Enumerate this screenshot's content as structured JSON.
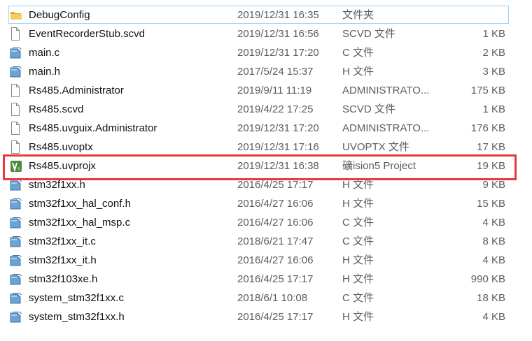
{
  "files": [
    {
      "name": "DebugConfig",
      "date": "2019/12/31 16:35",
      "type": "文件夹",
      "size": "",
      "icon": "folder-icon"
    },
    {
      "name": "EventRecorderStub.scvd",
      "date": "2019/12/31 16:56",
      "type": "SCVD 文件",
      "size": "1 KB",
      "icon": "document-icon"
    },
    {
      "name": "main.c",
      "date": "2019/12/31 17:20",
      "type": "C 文件",
      "size": "2 KB",
      "icon": "source-file-icon"
    },
    {
      "name": "main.h",
      "date": "2017/5/24 15:37",
      "type": "H 文件",
      "size": "3 KB",
      "icon": "source-file-icon"
    },
    {
      "name": "Rs485.Administrator",
      "date": "2019/9/11 11:19",
      "type": "ADMINISTRATO...",
      "size": "175 KB",
      "icon": "document-icon"
    },
    {
      "name": "Rs485.scvd",
      "date": "2019/4/22 17:25",
      "type": "SCVD 文件",
      "size": "1 KB",
      "icon": "document-icon"
    },
    {
      "name": "Rs485.uvguix.Administrator",
      "date": "2019/12/31 17:20",
      "type": "ADMINISTRATO...",
      "size": "176 KB",
      "icon": "document-icon"
    },
    {
      "name": "Rs485.uvoptx",
      "date": "2019/12/31 17:16",
      "type": "UVOPTX 文件",
      "size": "17 KB",
      "icon": "document-icon"
    },
    {
      "name": "Rs485.uvprojx",
      "date": "2019/12/31 16:38",
      "type": "礦ision5 Project",
      "size": "19 KB",
      "icon": "uvision-project-icon"
    },
    {
      "name": "stm32f1xx.h",
      "date": "2016/4/25 17:17",
      "type": "H 文件",
      "size": "9 KB",
      "icon": "source-file-icon"
    },
    {
      "name": "stm32f1xx_hal_conf.h",
      "date": "2016/4/27 16:06",
      "type": "H 文件",
      "size": "15 KB",
      "icon": "source-file-icon"
    },
    {
      "name": "stm32f1xx_hal_msp.c",
      "date": "2016/4/27 16:06",
      "type": "C 文件",
      "size": "4 KB",
      "icon": "source-file-icon"
    },
    {
      "name": "stm32f1xx_it.c",
      "date": "2018/6/21 17:47",
      "type": "C 文件",
      "size": "8 KB",
      "icon": "source-file-icon"
    },
    {
      "name": "stm32f1xx_it.h",
      "date": "2016/4/27 16:06",
      "type": "H 文件",
      "size": "4 KB",
      "icon": "source-file-icon"
    },
    {
      "name": "stm32f103xe.h",
      "date": "2016/4/25 17:17",
      "type": "H 文件",
      "size": "990 KB",
      "icon": "source-file-icon"
    },
    {
      "name": "system_stm32f1xx.c",
      "date": "2018/6/1 10:08",
      "type": "C 文件",
      "size": "18 KB",
      "icon": "source-file-icon"
    },
    {
      "name": "system_stm32f1xx.h",
      "date": "2016/4/25 17:17",
      "type": "H 文件",
      "size": "4 KB",
      "icon": "source-file-icon"
    }
  ],
  "colors": {
    "highlight_border": "#e8383d",
    "focus_border": "#99d1ff",
    "folder": "#f4c44e",
    "uvision": "#4a8a3c"
  }
}
